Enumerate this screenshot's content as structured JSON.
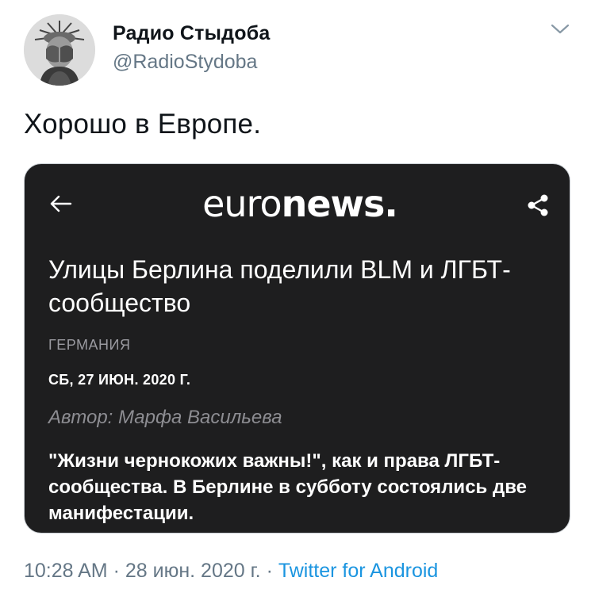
{
  "tweet": {
    "author_name": "Радио Стыдоба",
    "author_handle": "@RadioStydoba",
    "text": "Хорошо в Европе.",
    "time": "10:28 AM",
    "separator": "·",
    "date": "28 июн. 2020 г.",
    "source": "Twitter for Android"
  },
  "card": {
    "logo_part1": "euro",
    "logo_part2": "news",
    "logo_dot": ".",
    "headline": "Улицы Берлина поделили BLM и ЛГБТ-сообщество",
    "section": "ГЕРМАНИЯ",
    "date": "СБ, 27 ИЮН. 2020 Г.",
    "author": "Автор: Марфа Васильева",
    "lead": "\"Жизни чернокожих важны!\", как и права ЛГБТ-сообщества. В Берлине в субботу состоялись две манифестации."
  },
  "icons": {
    "avatar": "statue-of-liberty-facepalm-avatar",
    "caret": "chevron-down-icon",
    "back": "arrow-left-icon",
    "share": "share-icon"
  },
  "colors": {
    "card_background": "#1e1e1f",
    "link_blue": "#1b95e0",
    "secondary_gray": "#657786"
  }
}
